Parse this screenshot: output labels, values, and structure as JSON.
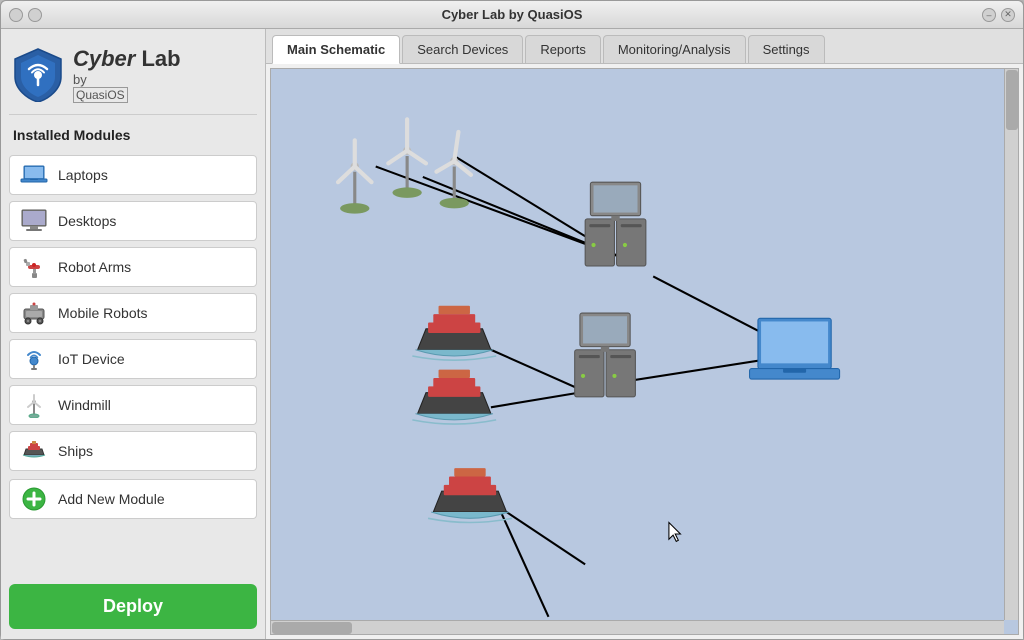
{
  "window": {
    "title": "Cyber Lab by QuasiOS",
    "controls": {
      "minimize": "–",
      "maximize": "□",
      "close": "✕"
    }
  },
  "sidebar": {
    "logo": {
      "brand": "Cyber Lab",
      "by": "by",
      "company": "QuasiOS"
    },
    "installed_modules_label": "Installed Modules",
    "modules": [
      {
        "id": "laptops",
        "label": "Laptops"
      },
      {
        "id": "desktops",
        "label": "Desktops"
      },
      {
        "id": "robot-arms",
        "label": "Robot Arms"
      },
      {
        "id": "mobile-robots",
        "label": "Mobile Robots"
      },
      {
        "id": "iot-device",
        "label": "IoT Device"
      },
      {
        "id": "windmill",
        "label": "Windmill"
      },
      {
        "id": "ships",
        "label": "Ships"
      }
    ],
    "add_module_label": "Add New Module",
    "deploy_label": "Deploy"
  },
  "tabs": [
    {
      "id": "main-schematic",
      "label": "Main Schematic",
      "active": true
    },
    {
      "id": "search-devices",
      "label": "Search Devices",
      "active": false
    },
    {
      "id": "reports",
      "label": "Reports",
      "active": false
    },
    {
      "id": "monitoring-analysis",
      "label": "Monitoring/Analysis",
      "active": false
    },
    {
      "id": "settings",
      "label": "Settings",
      "active": false
    }
  ],
  "colors": {
    "bg_schematic": "#b8c8e0",
    "deploy_green": "#3cb543",
    "sidebar_bg": "#e8e8e8"
  }
}
